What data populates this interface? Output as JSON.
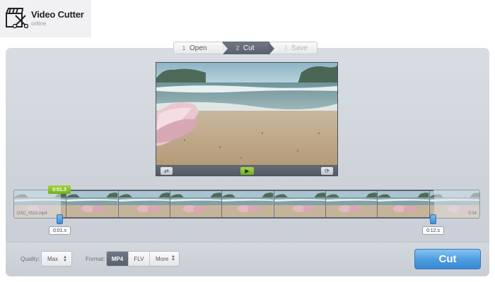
{
  "app": {
    "title": "Video Cutter",
    "subtitle": "online",
    "icon": "clapperboard-scissors-icon"
  },
  "steps": [
    {
      "num": "1",
      "label": "Open",
      "state": "done"
    },
    {
      "num": "2",
      "label": "Cut",
      "state": "active"
    },
    {
      "num": "3",
      "label": "Save",
      "state": "disabled"
    }
  ],
  "player": {
    "controls": [
      {
        "icon": "loop-icon",
        "glyph": "⇄"
      },
      {
        "icon": "play-icon",
        "glyph": "▶"
      },
      {
        "icon": "rotate-icon",
        "glyph": "⟳"
      }
    ]
  },
  "timeline": {
    "file_name": "DSC_0522.mp4",
    "duration_label": "0:14",
    "start_badge": "0:01.3",
    "start_time": "0:01.s",
    "end_time": "0:12.s",
    "frame_count": 9
  },
  "options": {
    "quality_label": "Quality:",
    "quality_value": "Max",
    "format_label": "Format:",
    "formats": [
      "MP4",
      "FLV",
      "More"
    ],
    "selected_format": "MP4"
  },
  "actions": {
    "cut_label": "Cut"
  },
  "colors": {
    "accent_green": "#7dbb22",
    "accent_blue": "#4b9be0",
    "active_step": "#5e6671"
  }
}
